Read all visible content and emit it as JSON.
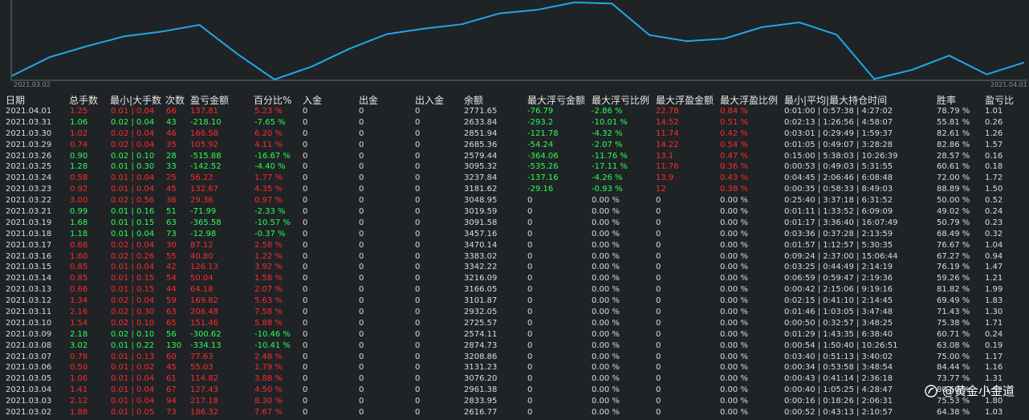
{
  "equity_chart": {
    "values": [
      2616.77,
      2833.95,
      2961.38,
      3076.2,
      3131.23,
      3208.86,
      2874.73,
      2574.11,
      2725.57,
      2932.05,
      3101.87,
      3166.05,
      3216.09,
      3342.22,
      3383.02,
      3470.14,
      3457.16,
      3091.58,
      3019.59,
      3048.95,
      3181.62,
      3237.84,
      3095.32,
      2579.44,
      2685.36,
      2851.94,
      2633.84,
      2771.65
    ],
    "start_label": "2021.03.02",
    "end_label": "2021.04.01",
    "line_color": "#1fa8e8"
  },
  "headers": {
    "date": "日期",
    "total_lots": "总手数",
    "min_max_lots": "最小|大手数",
    "count": "次数",
    "pnl": "盈亏金额",
    "pct": "百分比%",
    "deposit": "入金",
    "withdraw": "出金",
    "net_flow": "出入金",
    "balance": "余额",
    "max_float_loss": "最大浮亏金额",
    "max_float_loss_pct": "最大浮亏比例",
    "max_float_profit": "最大浮盈金额",
    "max_float_profit_pct": "最大浮盈比例",
    "hold_time": "最小|平均|最大持仓时间",
    "win_rate": "胜率",
    "pl_ratio": "盈亏比"
  },
  "rows": [
    {
      "date": "2021.04.01",
      "lots": "1.25",
      "minmax": "0.01 | 0.04",
      "count": "66",
      "pnl": "137.81",
      "pct": "5.23 %",
      "dep": "0",
      "wd": "0",
      "net": "0",
      "bal": "2771.65",
      "mfl": "-76.79",
      "mflp": "-2.86 %",
      "mfp": "22.78",
      "mfpp": "0.84 %",
      "hold": "0:01:00 | 0:57:38 | 4:27:02",
      "win": "78.79 %",
      "plr": "1.01",
      "sign": "pos",
      "float": "yes"
    },
    {
      "date": "2021.03.31",
      "lots": "1.06",
      "minmax": "0.02 | 0.04",
      "count": "43",
      "pnl": "-218.10",
      "pct": "-7.65 %",
      "dep": "0",
      "wd": "0",
      "net": "0",
      "bal": "2633.84",
      "mfl": "-293.2",
      "mflp": "-10.01 %",
      "mfp": "14.52",
      "mfpp": "0.51 %",
      "hold": "0:02:13 | 1:26:56 | 4:58:07",
      "win": "55.81 %",
      "plr": "0.26",
      "sign": "neg",
      "float": "yes"
    },
    {
      "date": "2021.03.30",
      "lots": "1.02",
      "minmax": "0.02 | 0.04",
      "count": "46",
      "pnl": "166.58",
      "pct": "6.20 %",
      "dep": "0",
      "wd": "0",
      "net": "0",
      "bal": "2851.94",
      "mfl": "-121.78",
      "mflp": "-4.32 %",
      "mfp": "11.74",
      "mfpp": "0.42 %",
      "hold": "0:03:01 | 0:29:49 | 1:59:37",
      "win": "82.61 %",
      "plr": "1.26",
      "sign": "pos",
      "float": "yes"
    },
    {
      "date": "2021.03.29",
      "lots": "0.74",
      "minmax": "0.02 | 0.04",
      "count": "35",
      "pnl": "105.92",
      "pct": "4.11 %",
      "dep": "0",
      "wd": "0",
      "net": "0",
      "bal": "2685.36",
      "mfl": "-54.24",
      "mflp": "-2.07 %",
      "mfp": "14.22",
      "mfpp": "0.54 %",
      "hold": "0:01:05 | 0:49:07 | 3:28:28",
      "win": "82.86 %",
      "plr": "1.57",
      "sign": "pos",
      "float": "yes"
    },
    {
      "date": "2021.03.26",
      "lots": "0.90",
      "minmax": "0.02 | 0.10",
      "count": "28",
      "pnl": "-515.88",
      "pct": "-16.67 %",
      "dep": "0",
      "wd": "0",
      "net": "0",
      "bal": "2579.44",
      "mfl": "-364.06",
      "mflp": "-11.76 %",
      "mfp": "13.1",
      "mfpp": "0.47 %",
      "hold": "0:15:00 | 5:38:03 | 10:26:39",
      "win": "28.57 %",
      "plr": "0.16",
      "sign": "neg",
      "float": "yes"
    },
    {
      "date": "2021.03.25",
      "lots": "1.28",
      "minmax": "0.01 | 0.30",
      "count": "33",
      "pnl": "-142.52",
      "pct": "-4.40 %",
      "dep": "0",
      "wd": "0",
      "net": "0",
      "bal": "3095.32",
      "mfl": "-535.26",
      "mflp": "-17.11 %",
      "mfp": "11.76",
      "mfpp": "0.36 %",
      "hold": "0:00:53 | 0:49:03 | 5:31:55",
      "win": "60.61 %",
      "plr": "0.18",
      "sign": "neg",
      "float": "yes"
    },
    {
      "date": "2021.03.24",
      "lots": "0.58",
      "minmax": "0.01 | 0.04",
      "count": "25",
      "pnl": "56.22",
      "pct": "1.77 %",
      "dep": "0",
      "wd": "0",
      "net": "0",
      "bal": "3237.84",
      "mfl": "-137.16",
      "mflp": "-4.26 %",
      "mfp": "13.9",
      "mfpp": "0.43 %",
      "hold": "0:04:45 | 2:06:46 | 6:08:48",
      "win": "72.00 %",
      "plr": "1.72",
      "sign": "pos",
      "float": "yes"
    },
    {
      "date": "2021.03.23",
      "lots": "0.92",
      "minmax": "0.01 | 0.04",
      "count": "45",
      "pnl": "132.67",
      "pct": "4.35 %",
      "dep": "0",
      "wd": "0",
      "net": "0",
      "bal": "3181.62",
      "mfl": "-29.16",
      "mflp": "-0.93 %",
      "mfp": "12",
      "mfpp": "0.38 %",
      "hold": "0:00:35 | 0:58:33 | 8:49:03",
      "win": "88.89 %",
      "plr": "1.50",
      "sign": "pos",
      "float": "yes"
    },
    {
      "date": "2021.03.22",
      "lots": "3.00",
      "minmax": "0.02 | 0.56",
      "count": "36",
      "pnl": "29.36",
      "pct": "0.97 %",
      "dep": "0",
      "wd": "0",
      "net": "0",
      "bal": "3048.95",
      "mfl": "0",
      "mflp": "0.00 %",
      "mfp": "0",
      "mfpp": "0.00 %",
      "hold": "0:25:40 | 3:37:18 | 6:31:52",
      "win": "50.00 %",
      "plr": "0.52",
      "sign": "pos",
      "float": "no"
    },
    {
      "date": "2021.03.21",
      "lots": "0.99",
      "minmax": "0.01 | 0.16",
      "count": "51",
      "pnl": "-71.99",
      "pct": "-2.33 %",
      "dep": "0",
      "wd": "0",
      "net": "0",
      "bal": "3019.59",
      "mfl": "0",
      "mflp": "0.00 %",
      "mfp": "0",
      "mfpp": "0.00 %",
      "hold": "0:01:11 | 1:33:52 | 6:09:09",
      "win": "49.02 %",
      "plr": "0.24",
      "sign": "neg",
      "float": "no"
    },
    {
      "date": "2021.03.19",
      "lots": "1.68",
      "minmax": "0.01 | 0.15",
      "count": "63",
      "pnl": "-365.58",
      "pct": "-10.57 %",
      "dep": "0",
      "wd": "0",
      "net": "0",
      "bal": "3091.58",
      "mfl": "0",
      "mflp": "0.00 %",
      "mfp": "0",
      "mfpp": "0.00 %",
      "hold": "0:01:17 | 3:36:40 | 16:07:49",
      "win": "50.79 %",
      "plr": "0.23",
      "sign": "neg",
      "float": "no"
    },
    {
      "date": "2021.03.18",
      "lots": "1.18",
      "minmax": "0.01 | 0.04",
      "count": "73",
      "pnl": "-12.98",
      "pct": "-0.37 %",
      "dep": "0",
      "wd": "0",
      "net": "0",
      "bal": "3457.16",
      "mfl": "0",
      "mflp": "0.00 %",
      "mfp": "0",
      "mfpp": "0.00 %",
      "hold": "0:03:36 | 0:37:28 | 2:13:59",
      "win": "68.49 %",
      "plr": "0.32",
      "sign": "neg",
      "float": "no"
    },
    {
      "date": "2021.03.17",
      "lots": "0.68",
      "minmax": "0.02 | 0.04",
      "count": "30",
      "pnl": "87.12",
      "pct": "2.58 %",
      "dep": "0",
      "wd": "0",
      "net": "0",
      "bal": "3470.14",
      "mfl": "0",
      "mflp": "0.00 %",
      "mfp": "0",
      "mfpp": "0.00 %",
      "hold": "0:01:57 | 1:12:57 | 5:30:35",
      "win": "76.67 %",
      "plr": "1.04",
      "sign": "pos",
      "float": "no"
    },
    {
      "date": "2021.03.16",
      "lots": "1.60",
      "minmax": "0.02 | 0.26",
      "count": "55",
      "pnl": "40.80",
      "pct": "1.22 %",
      "dep": "0",
      "wd": "0",
      "net": "0",
      "bal": "3383.02",
      "mfl": "0",
      "mflp": "0.00 %",
      "mfp": "0",
      "mfpp": "0.00 %",
      "hold": "0:09:24 | 2:37:00 | 15:06:44",
      "win": "67.27 %",
      "plr": "0.94",
      "sign": "pos",
      "float": "no"
    },
    {
      "date": "2021.03.15",
      "lots": "0.85",
      "minmax": "0.01 | 0.04",
      "count": "42",
      "pnl": "126.13",
      "pct": "3.92 %",
      "dep": "0",
      "wd": "0",
      "net": "0",
      "bal": "3342.22",
      "mfl": "0",
      "mflp": "0.00 %",
      "mfp": "0",
      "mfpp": "0.00 %",
      "hold": "0:03:25 | 0:44:49 | 2:14:19",
      "win": "76.19 %",
      "plr": "1.47",
      "sign": "pos",
      "float": "no"
    },
    {
      "date": "2021.03.14",
      "lots": "0.85",
      "minmax": "0.01 | 0.15",
      "count": "54",
      "pnl": "50.04",
      "pct": "1.58 %",
      "dep": "0",
      "wd": "0",
      "net": "0",
      "bal": "3216.09",
      "mfl": "0",
      "mflp": "0.00 %",
      "mfp": "0",
      "mfpp": "0.00 %",
      "hold": "0:06:59 | 0:59:47 | 2:19:36",
      "win": "59.26 %",
      "plr": "1.21",
      "sign": "pos",
      "float": "no"
    },
    {
      "date": "2021.03.13",
      "lots": "0.66",
      "minmax": "0.01 | 0.15",
      "count": "44",
      "pnl": "64.18",
      "pct": "2.07 %",
      "dep": "0",
      "wd": "0",
      "net": "0",
      "bal": "3166.05",
      "mfl": "0",
      "mflp": "0.00 %",
      "mfp": "0",
      "mfpp": "0.00 %",
      "hold": "0:00:42 | 2:15:06 | 9:19:16",
      "win": "81.82 %",
      "plr": "1.99",
      "sign": "pos",
      "float": "no"
    },
    {
      "date": "2021.03.12",
      "lots": "1.34",
      "minmax": "0.02 | 0.04",
      "count": "59",
      "pnl": "169.82",
      "pct": "5.63 %",
      "dep": "0",
      "wd": "0",
      "net": "0",
      "bal": "3101.87",
      "mfl": "0",
      "mflp": "0.00 %",
      "mfp": "0",
      "mfpp": "0.00 %",
      "hold": "0:02:15 | 0:41:10 | 2:14:45",
      "win": "69.49 %",
      "plr": "1.83",
      "sign": "pos",
      "float": "no"
    },
    {
      "date": "2021.03.11",
      "lots": "2.16",
      "minmax": "0.02 | 0.30",
      "count": "63",
      "pnl": "206.48",
      "pct": "7.58 %",
      "dep": "0",
      "wd": "0",
      "net": "0",
      "bal": "2932.05",
      "mfl": "0",
      "mflp": "0.00 %",
      "mfp": "0",
      "mfpp": "0.00 %",
      "hold": "0:01:46 | 1:03:05 | 3:47:48",
      "win": "71.43 %",
      "plr": "1.30",
      "sign": "pos",
      "float": "no"
    },
    {
      "date": "2021.03.10",
      "lots": "1.54",
      "minmax": "0.02 | 0.10",
      "count": "65",
      "pnl": "151.46",
      "pct": "5.88 %",
      "dep": "0",
      "wd": "0",
      "net": "0",
      "bal": "2725.57",
      "mfl": "0",
      "mflp": "0.00 %",
      "mfp": "0",
      "mfpp": "0.00 %",
      "hold": "0:00:50 | 0:32:57 | 3:48:25",
      "win": "75.38 %",
      "plr": "1.71",
      "sign": "pos",
      "float": "no"
    },
    {
      "date": "2021.03.09",
      "lots": "2.18",
      "minmax": "0.02 | 0.10",
      "count": "56",
      "pnl": "-300.62",
      "pct": "-10.46 %",
      "dep": "0",
      "wd": "0",
      "net": "0",
      "bal": "2574.11",
      "mfl": "0",
      "mflp": "0.00 %",
      "mfp": "0",
      "mfpp": "0.00 %",
      "hold": "0:01:29 | 1:43:35 | 6:38:40",
      "win": "60.71 %",
      "plr": "0.24",
      "sign": "neg",
      "float": "no"
    },
    {
      "date": "2021.03.08",
      "lots": "3.02",
      "minmax": "0.01 | 0.22",
      "count": "130",
      "pnl": "-334.13",
      "pct": "-10.41 %",
      "dep": "0",
      "wd": "0",
      "net": "0",
      "bal": "2874.73",
      "mfl": "0",
      "mflp": "0.00 %",
      "mfp": "0",
      "mfpp": "0.00 %",
      "hold": "0:00:54 | 1:50:40 | 10:26:51",
      "win": "63.08 %",
      "plr": "0.19",
      "sign": "neg",
      "float": "no"
    },
    {
      "date": "2021.03.07",
      "lots": "0.78",
      "minmax": "0.01 | 0.13",
      "count": "60",
      "pnl": "77.63",
      "pct": "2.48 %",
      "dep": "0",
      "wd": "0",
      "net": "0",
      "bal": "3208.86",
      "mfl": "0",
      "mflp": "0.00 %",
      "mfp": "0",
      "mfpp": "0.00 %",
      "hold": "0:03:40 | 0:51:13 | 3:40:02",
      "win": "75.00 %",
      "plr": "1.17",
      "sign": "pos",
      "float": "no"
    },
    {
      "date": "2021.03.06",
      "lots": "0.50",
      "minmax": "0.01 | 0.02",
      "count": "45",
      "pnl": "55.03",
      "pct": "1.79 %",
      "dep": "0",
      "wd": "0",
      "net": "0",
      "bal": "3131.23",
      "mfl": "0",
      "mflp": "0.00 %",
      "mfp": "0",
      "mfpp": "0.00 %",
      "hold": "0:00:34 | 0:53:58 | 3:48:54",
      "win": "84.44 %",
      "plr": "1.16",
      "sign": "pos",
      "float": "no"
    },
    {
      "date": "2021.03.05",
      "lots": "1.06",
      "minmax": "0.01 | 0.04",
      "count": "61",
      "pnl": "114.82",
      "pct": "3.88 %",
      "dep": "0",
      "wd": "0",
      "net": "0",
      "bal": "3076.20",
      "mfl": "0",
      "mflp": "0.00 %",
      "mfp": "0",
      "mfpp": "0.00 %",
      "hold": "0:00:43 | 0:41:14 | 2:36:18",
      "win": "73.77 %",
      "plr": "1.31",
      "sign": "pos",
      "float": "no"
    },
    {
      "date": "2021.03.04",
      "lots": "1.41",
      "minmax": "0.01 | 0.04",
      "count": "67",
      "pnl": "127.43",
      "pct": "4.50 %",
      "dep": "0",
      "wd": "0",
      "net": "0",
      "bal": "2961.38",
      "mfl": "0",
      "mflp": "0.00 %",
      "mfp": "0",
      "mfpp": "0.00 %",
      "hold": "0:00:40 | 1:05:25 | 4:28:47",
      "win": "80.60 %",
      "plr": "1.32",
      "sign": "pos",
      "float": "no"
    },
    {
      "date": "2021.03.03",
      "lots": "2.12",
      "minmax": "0.01 | 0.04",
      "count": "94",
      "pnl": "217.18",
      "pct": "8.30 %",
      "dep": "0",
      "wd": "0",
      "net": "0",
      "bal": "2833.95",
      "mfl": "0",
      "mflp": "0.00 %",
      "mfp": "0",
      "mfpp": "0.00 %",
      "hold": "0:00:16 | 0:18:26 | 2:06:31",
      "win": "75.53 %",
      "plr": "1.80",
      "sign": "pos",
      "float": "no"
    },
    {
      "date": "2021.03.02",
      "lots": "1.88",
      "minmax": "0.01 | 0.05",
      "count": "73",
      "pnl": "186.32",
      "pct": "7.67 %",
      "dep": "0",
      "wd": "0",
      "net": "0",
      "bal": "2616.77",
      "mfl": "0",
      "mflp": "0.00 %",
      "mfp": "0",
      "mfpp": "0.00 %",
      "hold": "0:00:52 | 0:43:13 | 2:10:57",
      "win": "64.38 %",
      "plr": "1.03",
      "sign": "pos",
      "float": "no"
    }
  ],
  "watermark": {
    "text": "@黄金小金道"
  }
}
